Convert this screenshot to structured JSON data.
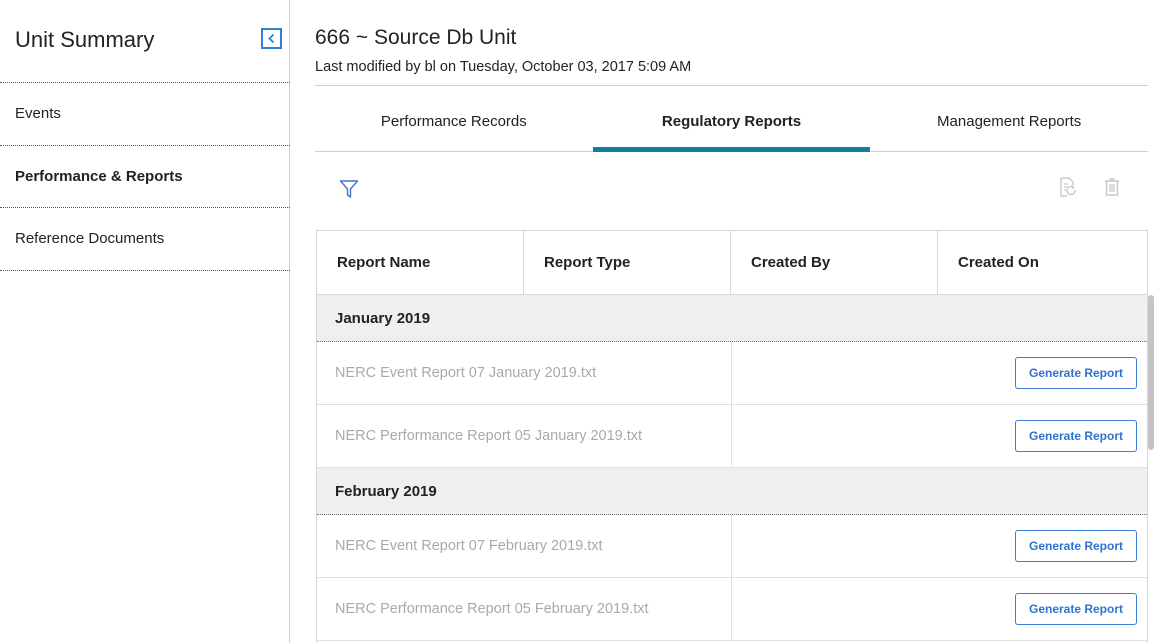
{
  "sidebar": {
    "title": "Unit Summary",
    "items": [
      {
        "label": "Events",
        "active": false
      },
      {
        "label": "Performance & Reports",
        "active": true
      },
      {
        "label": "Reference Documents",
        "active": false
      }
    ]
  },
  "header": {
    "title": "666 ~ Source Db Unit",
    "modified": "Last modified by bl on Tuesday, October 03, 2017 5:09 AM"
  },
  "tabs": [
    {
      "label": "Performance Records",
      "active": false
    },
    {
      "label": "Regulatory Reports",
      "active": true
    },
    {
      "label": "Management Reports",
      "active": false
    }
  ],
  "toolbar": {
    "filter_icon": "filter-icon",
    "refresh_icon": "document-refresh-icon",
    "delete_icon": "trash-icon"
  },
  "table": {
    "columns": [
      "Report Name",
      "Report Type",
      "Created By",
      "Created On"
    ],
    "groups": [
      {
        "label": "January 2019",
        "rows": [
          {
            "name": "NERC Event Report 07 January 2019.txt",
            "action": "Generate Report"
          },
          {
            "name": "NERC Performance Report 05 January 2019.txt",
            "action": "Generate Report"
          }
        ]
      },
      {
        "label": "February 2019",
        "rows": [
          {
            "name": "NERC Event Report 07 February 2019.txt",
            "action": "Generate Report"
          },
          {
            "name": "NERC Performance Report 05 February 2019.txt",
            "action": "Generate Report"
          }
        ]
      }
    ]
  },
  "colors": {
    "accent": "#137f9e",
    "link_blue": "#2f73d0",
    "muted_text": "#a9a9a9",
    "group_bg": "#efefef"
  }
}
